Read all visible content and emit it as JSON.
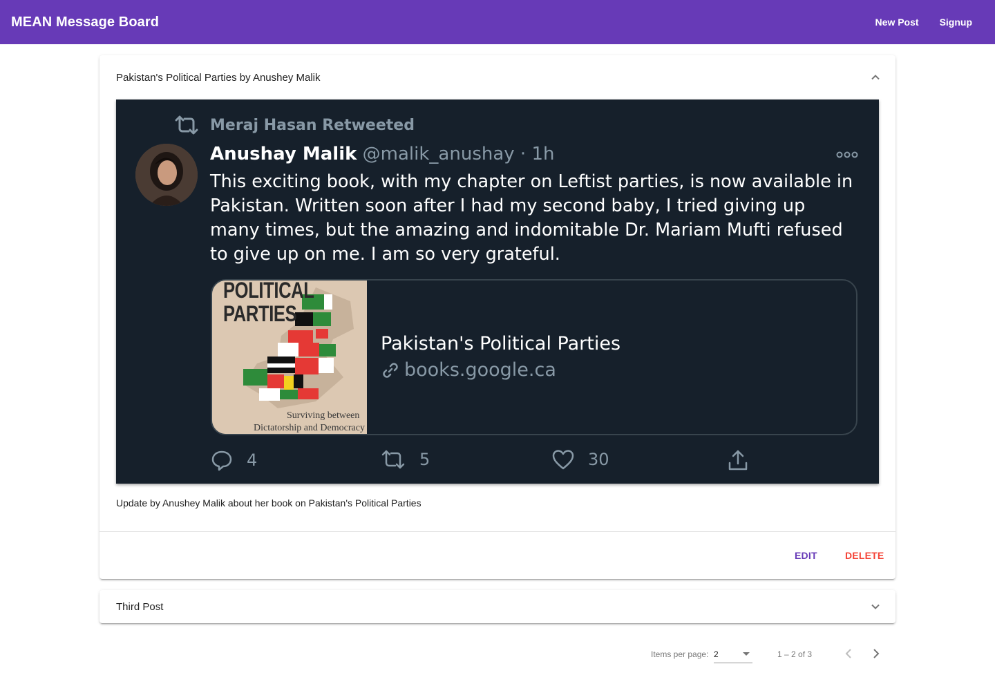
{
  "app": {
    "title": "MEAN Message Board",
    "nav": [
      "New Post",
      "Signup"
    ]
  },
  "posts": [
    {
      "title": "Pakistan's Political Parties by Anushey Malik",
      "expanded": true,
      "tweet": {
        "retweeted_by": "Meraj Hasan Retweeted",
        "author_name": "Anushay Malik",
        "handle_time": "@malik_anushay · 1h",
        "text": "This exciting book, with my chapter on Leftist parties, is now available in Pakistan. Written soon after I had my second baby, I tried giving up many times, but the amazing and indomitable Dr. Mariam Mufti refused to give up on me. I am so very grateful.",
        "card": {
          "book_title_line1": "POLITICAL",
          "book_title_line2": "PARTIES",
          "book_subtitle_line1": "Surviving between",
          "book_subtitle_line2": "Dictatorship and Democracy",
          "title": "Pakistan's Political Parties",
          "link": "books.google.ca"
        },
        "stats": {
          "replies": "4",
          "retweets": "5",
          "likes": "30"
        }
      },
      "content": "Update by Anushey Malik about her book on Pakistan's Political Parties",
      "actions": {
        "edit": "EDIT",
        "delete": "DELETE"
      }
    },
    {
      "title": "Third Post",
      "expanded": false
    }
  ],
  "paginator": {
    "items_per_page_label": "Items per page:",
    "page_size": "2",
    "range": "1 – 2 of 3"
  },
  "colors": {
    "primary": "#673ab7",
    "warn": "#f44336",
    "tweet_bg": "#16202b"
  }
}
